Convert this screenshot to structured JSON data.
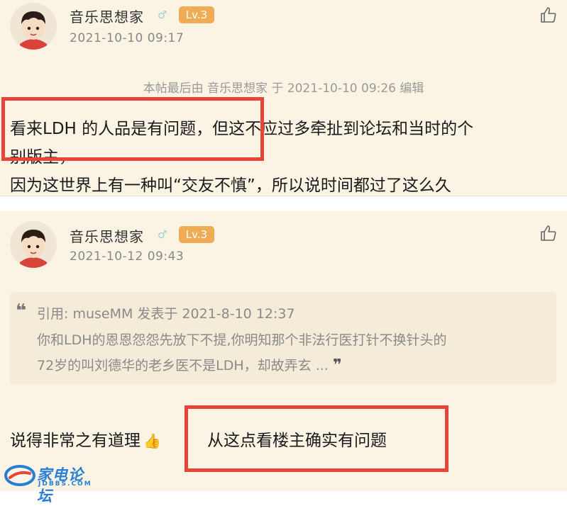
{
  "post1": {
    "username": "音乐思想家",
    "gender_symbol": "♂",
    "level": "Lv.3",
    "timestamp": "2021-10-10 09:17",
    "edit_note": "本帖最后由 音乐思想家 于 2021-10-10 09:26 编辑",
    "lines": [
      "看来LDH 的人品是有问题，但这不应过多牵扯到论坛和当时的个",
      "别版主，",
      "因为这世界上有一种叫“交友不慎”，所以说时间都过了这么久"
    ]
  },
  "post2": {
    "username": "音乐思想家",
    "gender_symbol": "♂",
    "level": "Lv.3",
    "timestamp": "2021-10-12 09:43",
    "quote": {
      "header": "引用: museMM 发表于 2021-8-10 12:37",
      "lines": [
        "你和LDH的恩恩怨怨先放下不提,你明知那个非法行医打针不换针头的",
        "72岁的叫刘德华的老乡医不是LDH，却故弄玄 ..."
      ]
    },
    "reply_text": "说得非常之有道理",
    "reply_emoji": "👍",
    "highlight_text": "从这点看楼主确实有问题"
  },
  "watermark": {
    "text": "家电论坛",
    "sub": "JDBBS.COM"
  },
  "icons": {
    "avatar": "cartoon-boy-avatar-icon",
    "like": "thumbs-up-icon",
    "quote_open": "open-quote-icon",
    "quote_close": "close-quote-icon"
  },
  "colors": {
    "background": "#fbf3e4",
    "level_badge": "#f0ab55",
    "highlight_border": "#e8453a",
    "watermark": "#2a7fd4"
  }
}
